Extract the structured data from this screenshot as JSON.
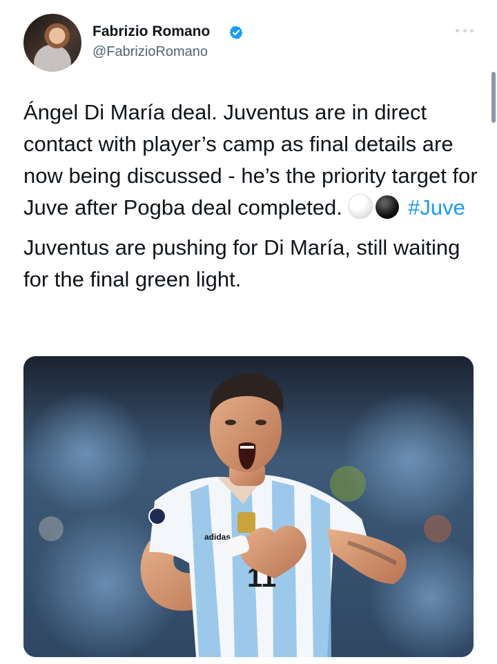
{
  "author": {
    "display_name": "Fabrizio Romano",
    "handle": "@FabrizioRomano",
    "verified": true,
    "avatar_icon": "profile-photo"
  },
  "tweet": {
    "text_main": "Ángel Di María deal. Juventus are in direct contact with player’s camp as final details are now being discussed - he’s the priority target for Juve after Pogba deal completed.",
    "hashtag": "#Juve",
    "text_second": "Juventus are pushing for Di María, still waiting for the final green light."
  },
  "media": {
    "jersey_number": "11",
    "jersey_brand": "adidas"
  },
  "colors": {
    "link": "#1d9bf0",
    "secondary_text": "#536471",
    "verified": "#1d9bf0"
  }
}
